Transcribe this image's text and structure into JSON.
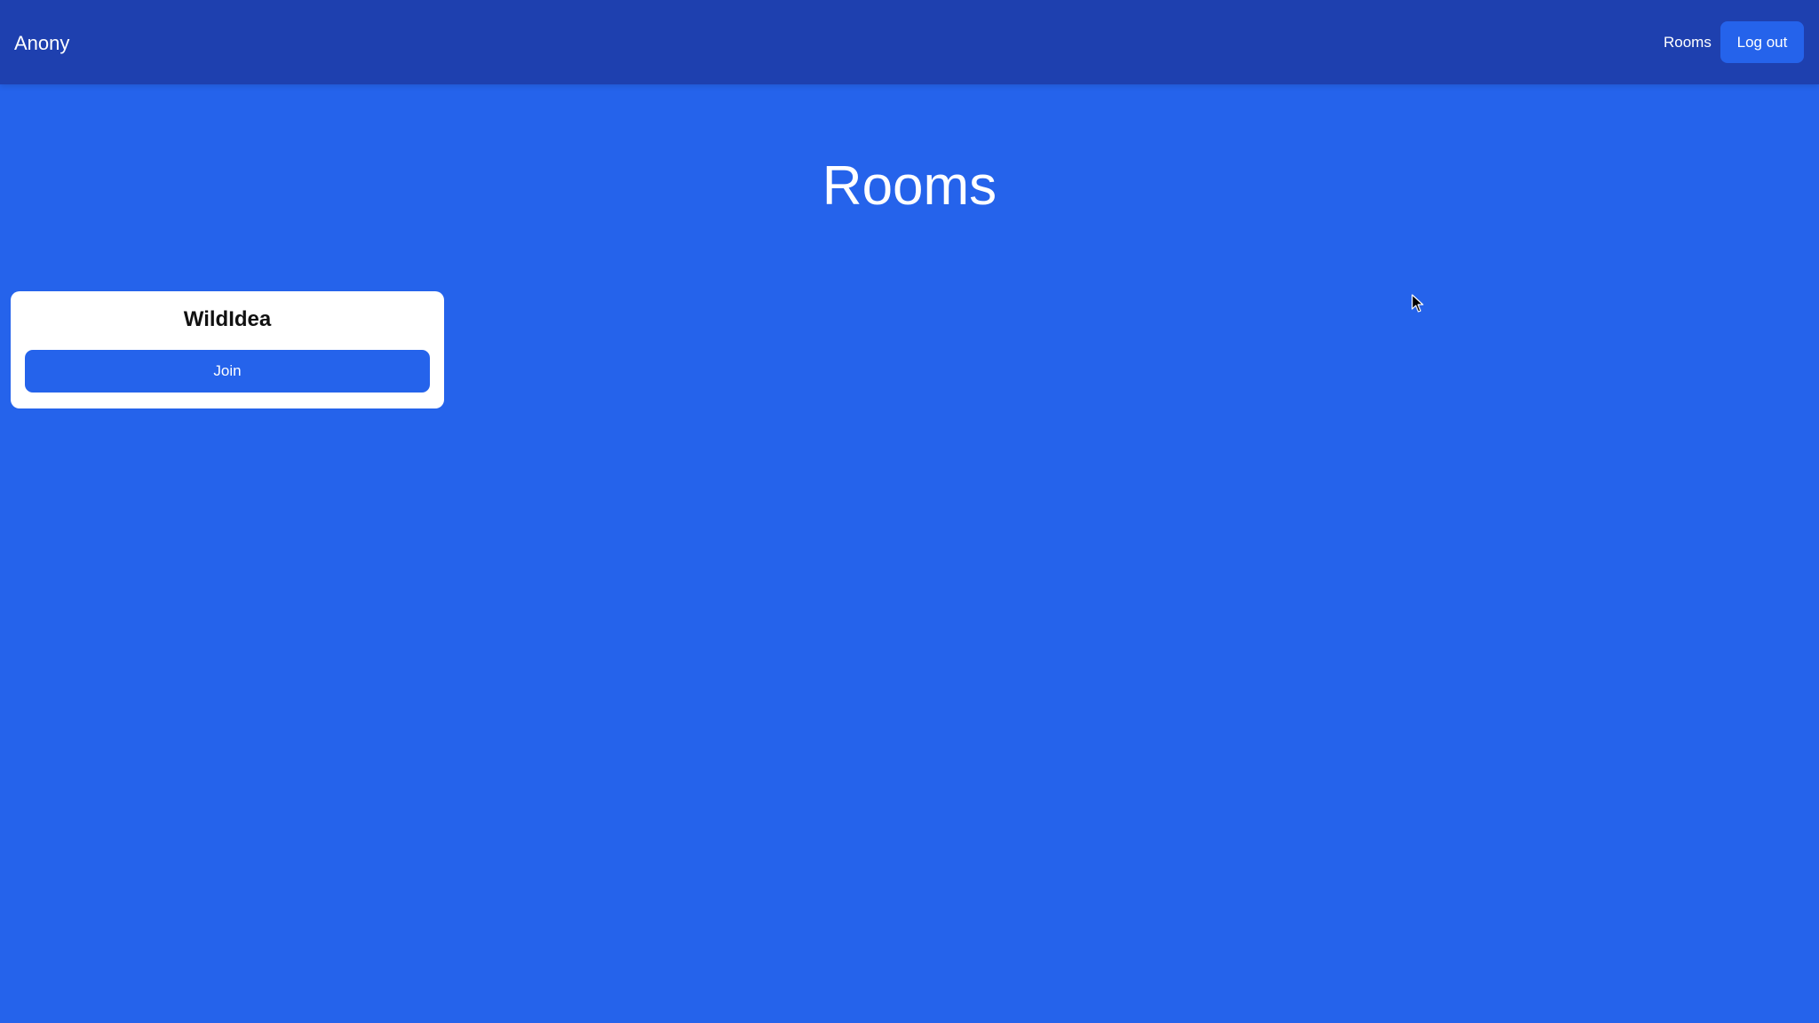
{
  "navbar": {
    "brand": "Anony",
    "links": {
      "rooms": "Rooms"
    },
    "logout_label": "Log out"
  },
  "main": {
    "title": "Rooms",
    "rooms": [
      {
        "name": "WildIdea",
        "join_label": "Join"
      }
    ]
  },
  "colors": {
    "page_background": "#2563eb",
    "navbar_background": "#1e40af",
    "button_background": "#2563eb",
    "card_background": "#ffffff"
  },
  "icons": {
    "cursor": "mouse-pointer-icon"
  }
}
